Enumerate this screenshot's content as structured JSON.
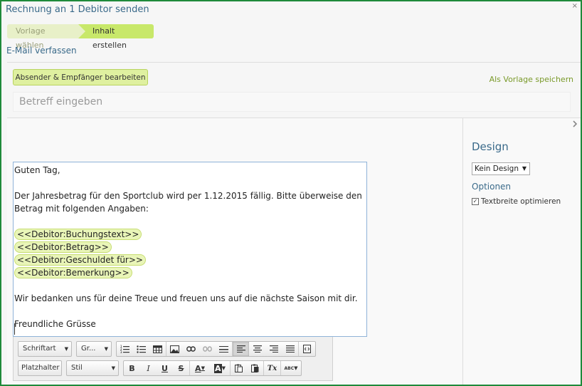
{
  "window": {
    "title": "Rechnung an 1 Debitor senden",
    "close_glyph": "×"
  },
  "wizard": {
    "steps": [
      {
        "label": "Vorlage wählen",
        "state": "done"
      },
      {
        "label": "Inhalt erstellen",
        "state": "active"
      }
    ]
  },
  "section": {
    "title": "E-Mail verfassen"
  },
  "actions": {
    "sender_button": "Absender & Empfänger bearbeiten",
    "save_template": "Als Vorlage speichern"
  },
  "subject": {
    "placeholder": "Betreff eingeben",
    "value": ""
  },
  "editor": {
    "greeting": "Guten Tag,",
    "paragraph1_line1": "Der Jahresbetrag für den Sportclub wird per 1.12.2015 fällig. Bitte überweise den",
    "paragraph1_line2": "Betrag mit folgenden Angaben:",
    "placeholders": [
      "<<Debitor:Buchungstext>>",
      "<<Debitor:Betrag>>",
      "<<Debitor:Geschuldet für>>",
      "<<Debitor:Bemerkung>>"
    ],
    "paragraph2": "Wir bedanken uns für deine Treue und freuen uns auf die nächste Saison mit dir.",
    "closing": "Freundliche Grüsse"
  },
  "toolbar": {
    "font_select": "Schriftart",
    "size_select": "Gr...",
    "placeholder_button": "Platzhalter",
    "style_select": "Stil",
    "icons_row1": [
      "ordered-list-icon",
      "bullet-list-icon",
      "table-icon",
      "image-icon",
      "link-icon",
      "unlink-icon",
      "horizontal-rule-icon",
      "align-left-icon",
      "align-center-icon",
      "align-right-icon",
      "align-justify-icon",
      "source-icon"
    ],
    "icons_row2": [
      "bold-icon",
      "italic-icon",
      "underline-icon",
      "strikethrough-icon",
      "text-color-icon",
      "background-color-icon",
      "paste-text-icon",
      "paste-word-icon",
      "remove-format-icon",
      "spellcheck-icon"
    ],
    "bold": "B",
    "italic": "I",
    "underline": "U",
    "strike": "S",
    "text_color": "A",
    "bg_color": "A",
    "remove_format": "Tx",
    "spellcheck": "ABC"
  },
  "sidebar": {
    "design_title": "Design",
    "design_value": "Kein Design",
    "options_title": "Optionen",
    "option_textwidth": "Textbreite optimieren",
    "option_textwidth_checked": true
  }
}
